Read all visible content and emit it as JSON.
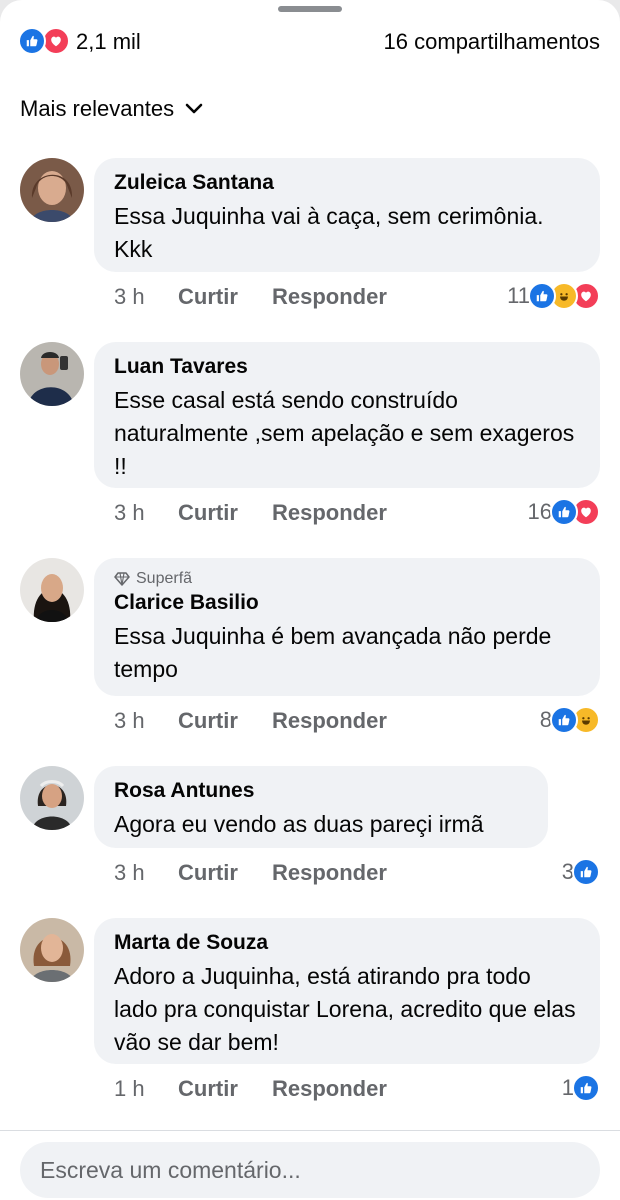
{
  "summary": {
    "total_reactions": "2,1 mil",
    "shares": "16 compartilhamentos",
    "reaction_icons": [
      "like-icon",
      "love-icon"
    ]
  },
  "sort": {
    "label": "Mais relevantes",
    "icon": "chevron-down-icon"
  },
  "comments": [
    {
      "author": "Zuleica Santana",
      "text": "Essa Juquinha vai à caça, sem cerimônia. Kkk",
      "time": "3 h",
      "like_label": "Curtir",
      "reply_label": "Responder",
      "reaction_count": "11",
      "reactions": [
        "like-icon",
        "haha-icon",
        "love-icon"
      ]
    },
    {
      "author": "Luan Tavares",
      "text": "Esse casal está sendo construído naturalmente ,sem apelação e sem exageros !!",
      "time": "3 h",
      "like_label": "Curtir",
      "reply_label": "Responder",
      "reaction_count": "16",
      "reactions": [
        "like-icon",
        "love-icon"
      ]
    },
    {
      "badge": "Superfã",
      "author": "Clarice Basilio",
      "text": "Essa Juquinha é bem avançada não perde tempo",
      "time": "3 h",
      "like_label": "Curtir",
      "reply_label": "Responder",
      "reaction_count": "8",
      "reactions": [
        "like-icon",
        "haha-icon"
      ]
    },
    {
      "author": "Rosa Antunes",
      "text": "Agora  eu vendo as duas pareçi irmã",
      "time": "3 h",
      "like_label": "Curtir",
      "reply_label": "Responder",
      "reaction_count": "3",
      "reactions": [
        "like-icon"
      ]
    },
    {
      "author": "Marta de Souza",
      "text": "Adoro  a Juquinha, está  atirando pra todo lado pra  conquistar  Lorena, acredito que  elas vão  se dar bem!",
      "time": "1 h",
      "like_label": "Curtir",
      "reply_label": "Responder",
      "reaction_count": "1",
      "reactions": [
        "like-icon"
      ]
    }
  ],
  "composer": {
    "placeholder": "Escreva um comentário..."
  },
  "colors": {
    "like": "#1b74e4",
    "love": "#f33e58",
    "haha": "#f7b928",
    "bubble": "#f0f2f5",
    "secondary_text": "#65676b"
  }
}
